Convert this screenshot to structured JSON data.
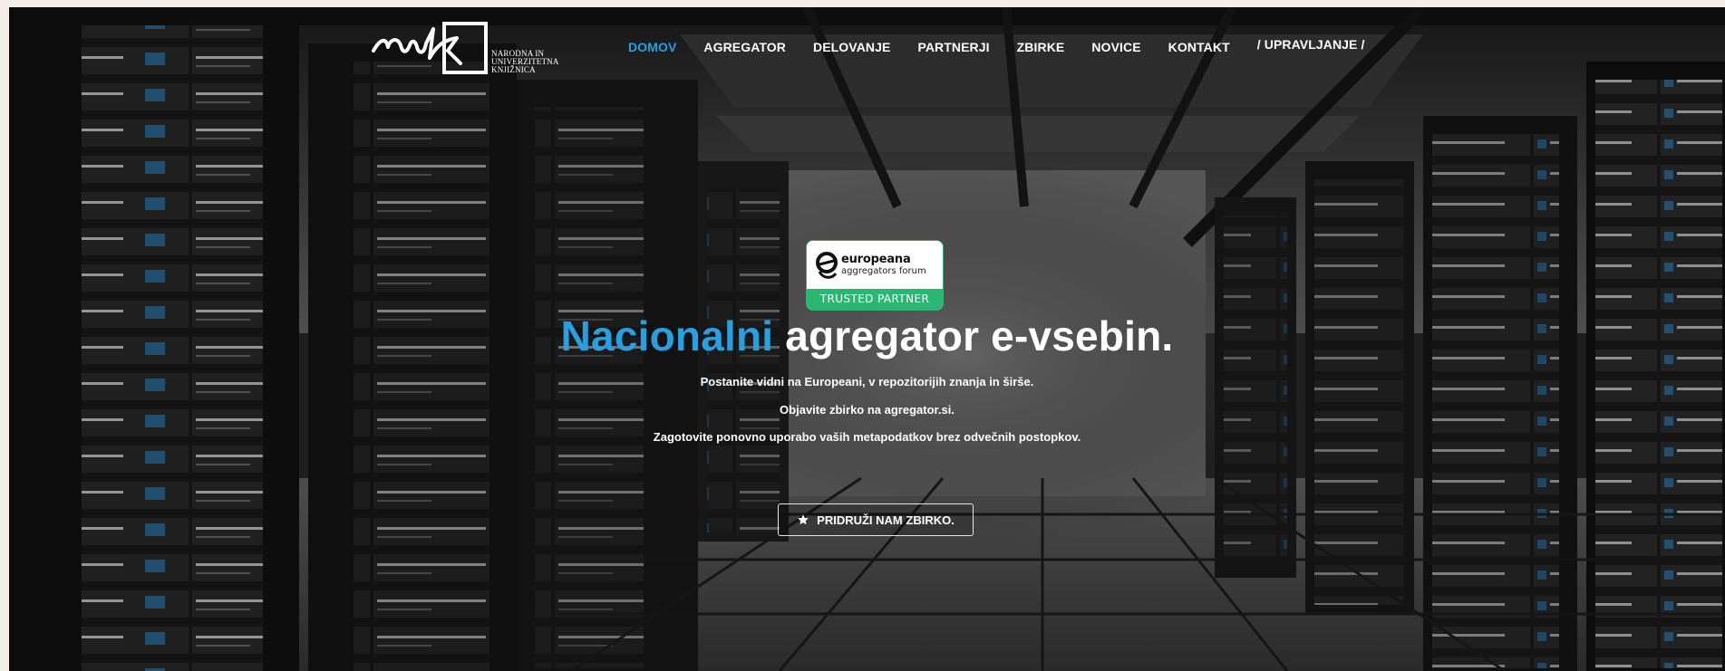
{
  "brand": {
    "logo_mark": "nuk",
    "name_lines": [
      "NARODNA IN",
      "UNIVERZITETNA",
      "KNJIŽNICA"
    ]
  },
  "nav": {
    "items": [
      {
        "label": "DOMOV",
        "active": true
      },
      {
        "label": "AGREGATOR",
        "active": false
      },
      {
        "label": "DELOVANJE",
        "active": false
      },
      {
        "label": "PARTNERJI",
        "active": false
      },
      {
        "label": "ZBIRKE",
        "active": false
      },
      {
        "label": "NOVICE",
        "active": false
      },
      {
        "label": "KONTAKT",
        "active": false
      },
      {
        "label": "/ UPRAVLJANJE /",
        "active": false
      }
    ]
  },
  "badge": {
    "brand": "europeana",
    "sub": "aggregators forum",
    "status": "TRUSTED PARTNER"
  },
  "hero": {
    "title_highlight": "Nacionalni",
    "title_rest": " agregator e-vsebin.",
    "lines": [
      "Postanite vidni na Europeani, v repozitorijih znanja in širše.",
      "Objavite zbirko na agregator.si.",
      "Zagotovite ponovno uporabo vaših metapodatkov brez odvečnih postopkov."
    ],
    "cta_label": "PRIDRUŽI NAM ZBIRKO.",
    "cta_icon": "star-icon"
  },
  "colors": {
    "accent": "#2a9fe0",
    "badge_green": "#2bb673",
    "text": "#ffffff"
  }
}
